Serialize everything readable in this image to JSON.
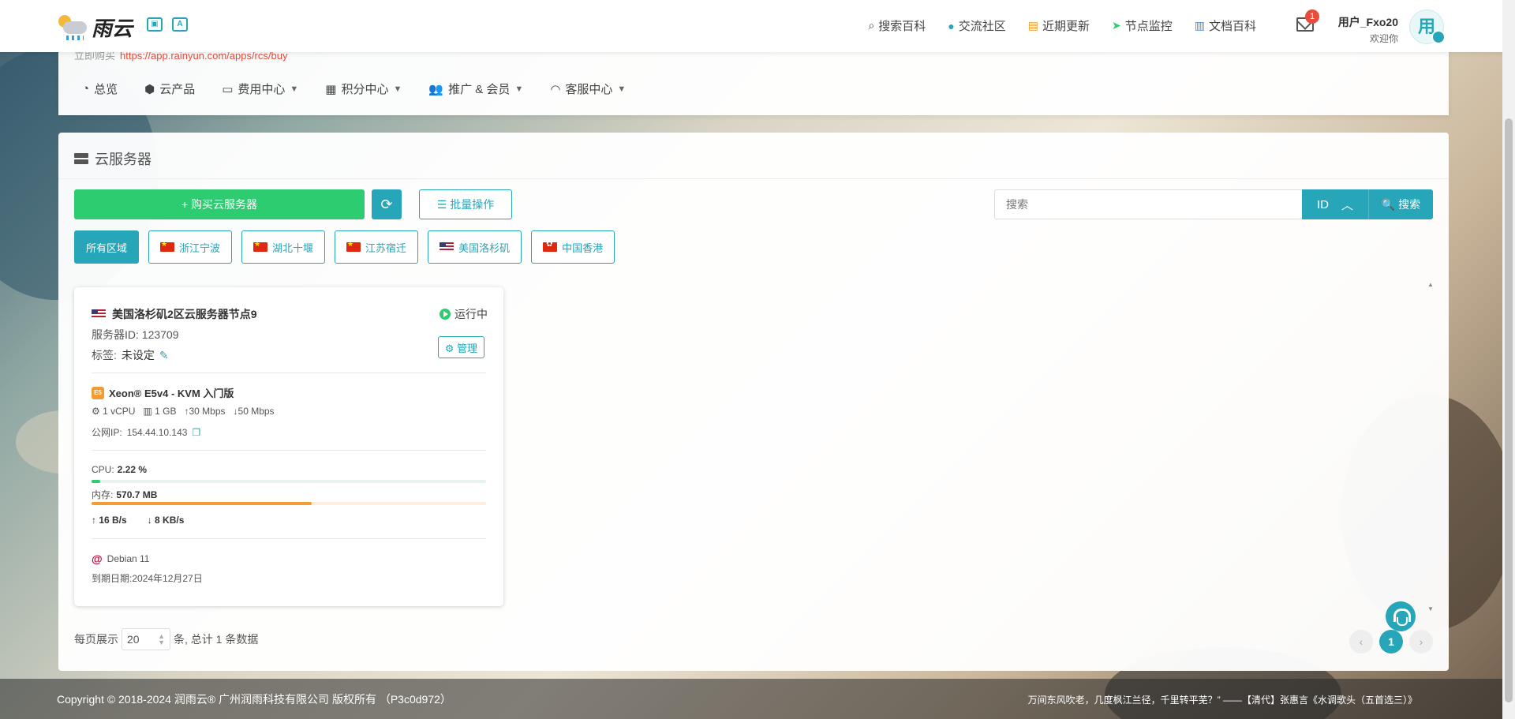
{
  "brand": {
    "name": "雨云"
  },
  "topnav": [
    {
      "icon": "search-icon",
      "label": "搜索百科"
    },
    {
      "icon": "community-icon",
      "label": "交流社区"
    },
    {
      "icon": "updates-icon",
      "label": "近期更新"
    },
    {
      "icon": "send-icon",
      "label": "节点监控"
    },
    {
      "icon": "book-icon",
      "label": "文档百科"
    }
  ],
  "notifications": {
    "count": "1"
  },
  "user": {
    "name": "用户_Fxo20",
    "welcome": "欢迎你",
    "avatar_text": "用"
  },
  "hidden_strip": {
    "prefix": "立即购买",
    "url": "https://app.rainyun.com/apps/rcs/buy"
  },
  "subnav": [
    {
      "label": "总览",
      "caret": false
    },
    {
      "label": "云产品",
      "caret": false
    },
    {
      "label": "费用中心",
      "caret": true
    },
    {
      "label": "积分中心",
      "caret": true
    },
    {
      "label": "推广 & 会员",
      "caret": true
    },
    {
      "label": "客服中心",
      "caret": true
    }
  ],
  "panel": {
    "title": "云服务器"
  },
  "toolbar": {
    "buy_label": "+ 购买云服务器",
    "refresh_glyph": "⟳",
    "batch_label": "☰ 批量操作",
    "search_placeholder": "搜索",
    "search_field": "ID",
    "search_label": "🔍 搜索"
  },
  "regions": [
    {
      "label": "所有区域",
      "flag": "",
      "active": true
    },
    {
      "label": "浙江宁波",
      "flag": "cn",
      "active": false
    },
    {
      "label": "湖北十堰",
      "flag": "cn",
      "active": false
    },
    {
      "label": "江苏宿迁",
      "flag": "cn",
      "active": false
    },
    {
      "label": "美国洛杉矶",
      "flag": "us",
      "active": false
    },
    {
      "label": "中国香港",
      "flag": "hk",
      "active": false
    }
  ],
  "server": {
    "name": "美国洛杉矶2区云服务器节点9",
    "status": "运行中",
    "id_label": "服务器ID:",
    "id": "123709",
    "tag_label": "标签:",
    "tag": "未设定",
    "manage_label": "⚙ 管理",
    "plan": "Xeon® E5v4 - KVM 入门版",
    "cpu_spec": "1 vCPU",
    "ram_spec": "1 GB",
    "up_bw": "↑30 Mbps",
    "down_bw": "↓50 Mbps",
    "ip_label": "公网IP:",
    "ip": "154.44.10.143",
    "cpu_label": "CPU:",
    "cpu_usage": "2.22 %",
    "cpu_fraction": 0.0222,
    "mem_label": "内存:",
    "mem_usage": "570.7 MB",
    "mem_fraction": 0.557,
    "net_up": "↑  16 B/s",
    "net_down": "↓  8 KB/s",
    "os": "Debian 11",
    "expire_label": "到期日期:",
    "expire": "2024年12月27日"
  },
  "pagination": {
    "per_page_label": "每页展示",
    "per_page": "20",
    "total_text": "条, 总计 1 条数据",
    "current_page": "1",
    "prev": "‹",
    "next": "›"
  },
  "footer": {
    "copyright": "Copyright © 2018-2024 润雨云® 广州润雨科技有限公司 版权所有 （P3c0d972）",
    "poem": "万间东风吹老，几度枫江兰径，千里转平芜？” ——【清代】张惠言《水调歌头（五首选三）》"
  },
  "colors": {
    "accent": "#26a6b8",
    "buy": "#2ecc71",
    "mem_bar": "#f39c34",
    "cpu_bar": "#2ecc71"
  }
}
